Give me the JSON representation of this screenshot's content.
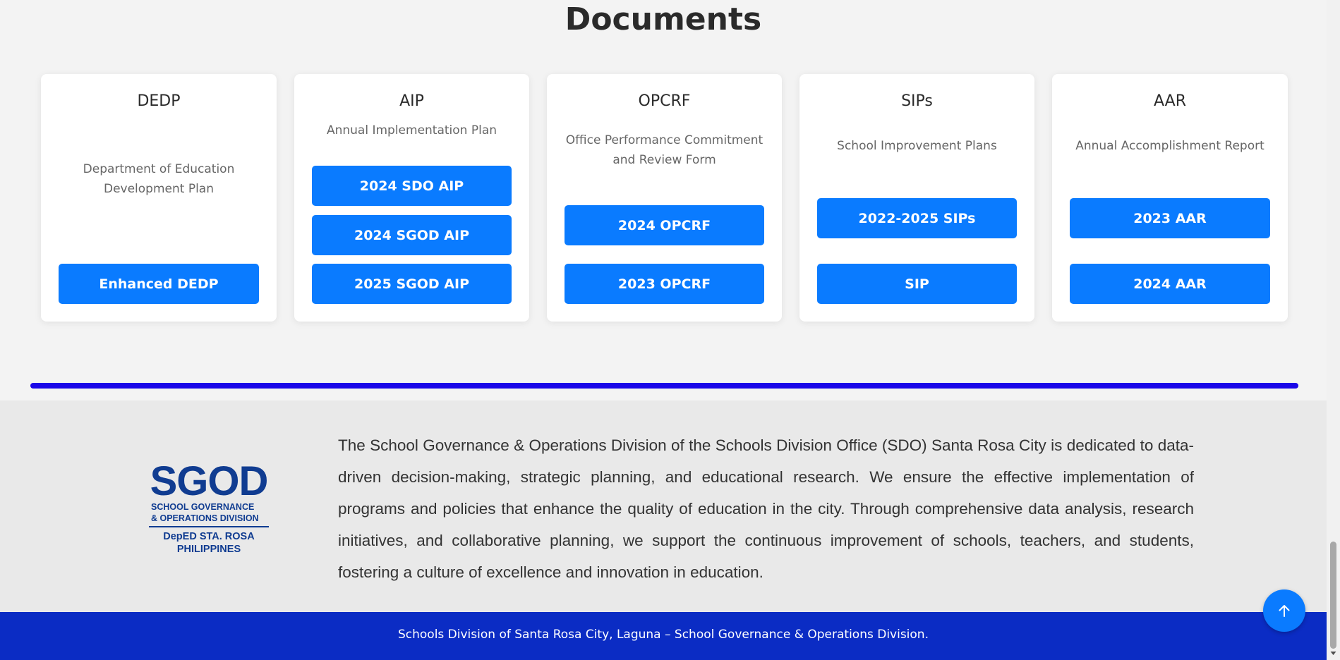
{
  "section": {
    "title": "Documents"
  },
  "cards": [
    {
      "title": "DEDP",
      "description": "Department of Education Development Plan",
      "buttons": [
        "Enhanced DEDP"
      ]
    },
    {
      "title": "AIP",
      "description": "Annual Implementation Plan",
      "buttons": [
        "2024 SDO AIP",
        "2024 SGOD AIP",
        "2025 SGOD AIP"
      ]
    },
    {
      "title": "OPCRF",
      "description": "Office Performance Commitment and Review Form",
      "buttons": [
        "2024 OPCRF",
        "2023 OPCRF"
      ]
    },
    {
      "title": "SIPs",
      "description": "School Improvement Plans",
      "buttons": [
        "2022-2025 SIPs",
        "SIP"
      ]
    },
    {
      "title": "AAR",
      "description": "Annual Accomplishment Report",
      "buttons": [
        "2023 AAR",
        "2024 AAR"
      ]
    }
  ],
  "logo": {
    "main": "SGOD",
    "line1": "SCHOOL GOVERNANCE",
    "line2": "& OPERATIONS DIVISION",
    "line3": "DepED STA. ROSA",
    "line4": "PHILIPPINES"
  },
  "about": "The School Governance & Operations Division of the Schools Division Office (SDO) Santa Rosa City is dedicated to data-driven decision-making, strategic planning, and educational research. We ensure the effective implementation of programs and policies that enhance the quality of education in the city. Through comprehensive data analysis, research initiatives, and collaborative planning, we support the continuous improvement of schools, teachers, and students, fostering a culture of excellence and innovation in education.",
  "footer": {
    "copyright": "Schools Division of Santa Rosa City, Laguna – School Governance & Operations Division."
  },
  "back_to_top": {
    "icon": "arrow-up-icon"
  },
  "colors": {
    "button": "#0a7bff",
    "divider": "#1a06e8",
    "footer": "#0b2cc4",
    "logo": "#103c91"
  }
}
